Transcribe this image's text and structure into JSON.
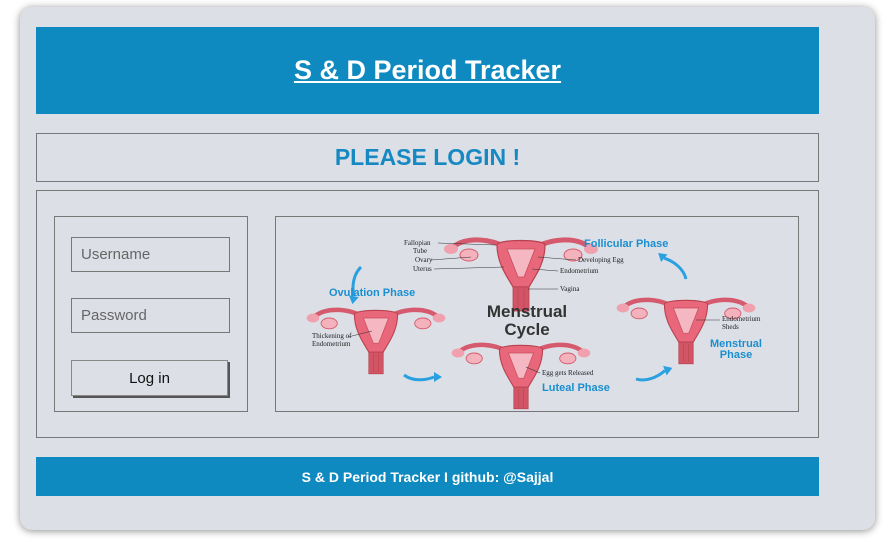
{
  "header": {
    "title": "S & D Period Tracker"
  },
  "login": {
    "heading": "PLEASE LOGIN !",
    "username_placeholder": "Username",
    "password_placeholder": "Password",
    "button_label": "Log in"
  },
  "diagram": {
    "title_line1": "Menstrual",
    "title_line2": "Cycle",
    "follicular_phase": "Follicular Phase",
    "ovulation_phase": "Ovulation Phase",
    "luteal_phase": "Luteal Phase",
    "menstrual_phase_line1": "Menstrual",
    "menstrual_phase_line2": "Phase",
    "label_fallopian": "Fallopian",
    "label_tube": "Tube",
    "label_ovary": "Ovary",
    "label_uterus": "Uterus",
    "label_developing_egg": "Developing Egg",
    "label_endometrium": "Endometrium",
    "label_vagina": "Vagina",
    "label_thickening": "Thickening of",
    "label_endometrium2": "Endometrium",
    "label_egg_released": "Egg gets Released",
    "label_endometrium_sheds1": "Endometrium",
    "label_endometrium_sheds2": "Sheds",
    "accent_blue": "#1a8fd0",
    "uterus_color": "#e8677a"
  },
  "footer": {
    "text": "S & D Period Tracker I github: @Sajjal"
  }
}
